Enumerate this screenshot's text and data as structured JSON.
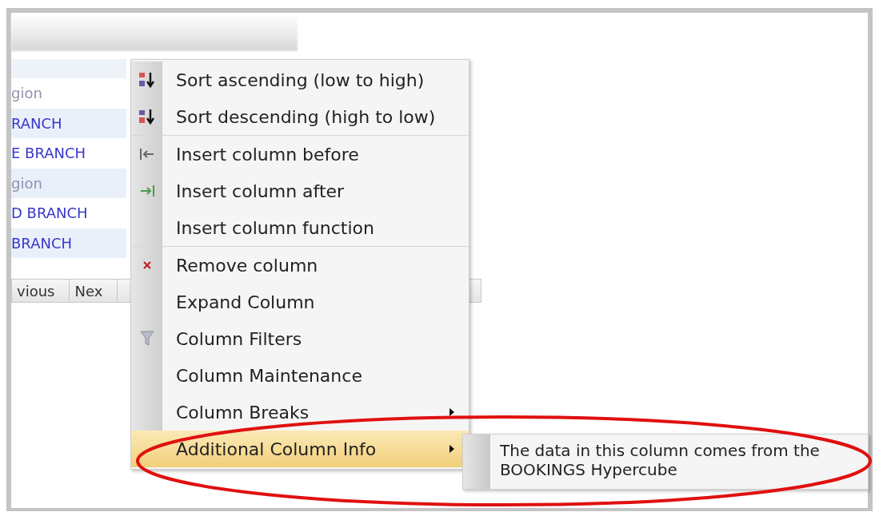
{
  "grid": {
    "rows": [
      {
        "text": "gion",
        "kind": "group"
      },
      {
        "text": "RANCH",
        "kind": "branch"
      },
      {
        "text": "E BRANCH",
        "kind": "branch"
      },
      {
        "text": "gion",
        "kind": "group"
      },
      {
        "text": "D BRANCH",
        "kind": "branch"
      },
      {
        "text": "BRANCH",
        "kind": "branch"
      }
    ]
  },
  "pager": {
    "buttons": [
      "vious",
      "Nex"
    ]
  },
  "context_menu": {
    "items": [
      {
        "label": "Sort ascending (low to high)",
        "kind": "sort-ascending",
        "has_submenu": false,
        "highlighted": false,
        "separator_after": false
      },
      {
        "label": "Sort descending (high to low)",
        "kind": "sort-descending",
        "has_submenu": false,
        "highlighted": false,
        "separator_after": true
      },
      {
        "label": "Insert column before",
        "kind": "insert-before",
        "has_submenu": false,
        "highlighted": false,
        "separator_after": false
      },
      {
        "label": "Insert column after",
        "kind": "insert-after",
        "has_submenu": false,
        "highlighted": false,
        "separator_after": false
      },
      {
        "label": "Insert column function",
        "kind": "plain",
        "has_submenu": false,
        "highlighted": false,
        "separator_after": true
      },
      {
        "label": "Remove column",
        "kind": "remove",
        "has_submenu": false,
        "highlighted": false,
        "separator_after": false
      },
      {
        "label": "Expand Column",
        "kind": "plain",
        "has_submenu": false,
        "highlighted": false,
        "separator_after": false
      },
      {
        "label": "Column Filters",
        "kind": "filter",
        "has_submenu": false,
        "highlighted": false,
        "separator_after": false
      },
      {
        "label": "Column Maintenance",
        "kind": "plain",
        "has_submenu": false,
        "highlighted": false,
        "separator_after": false
      },
      {
        "label": "Column Breaks",
        "kind": "plain",
        "has_submenu": true,
        "highlighted": false,
        "separator_after": false
      },
      {
        "label": "Additional Column Info",
        "kind": "plain",
        "has_submenu": true,
        "highlighted": true,
        "separator_after": false
      }
    ]
  },
  "submenu": {
    "text": "The data in this column comes from the BOOKINGS Hypercube"
  }
}
